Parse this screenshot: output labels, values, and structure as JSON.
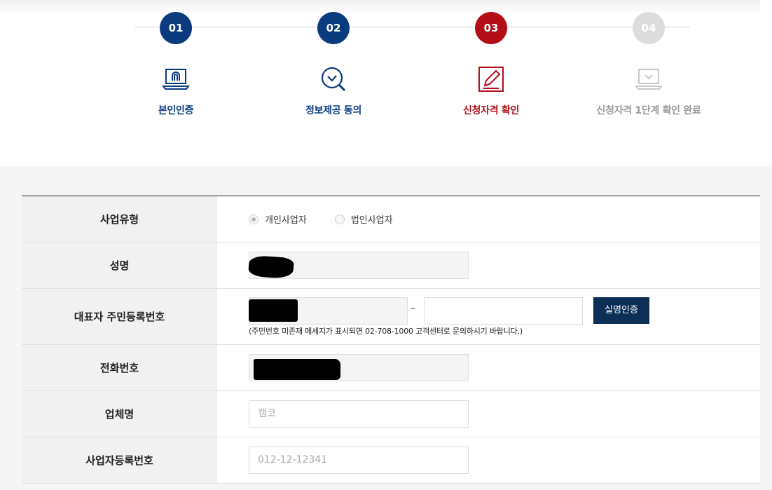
{
  "steps": [
    {
      "num": "01",
      "label": "본인인증",
      "icon": "fingerprint-laptop-icon",
      "state": "done"
    },
    {
      "num": "02",
      "label": "정보제공 동의",
      "icon": "magnifier-check-icon",
      "state": "done"
    },
    {
      "num": "03",
      "label": "신청자격 확인",
      "icon": "document-pen-icon",
      "state": "active"
    },
    {
      "num": "04",
      "label": "신청자격 1단계 확인 완료",
      "icon": "laptop-check-icon",
      "state": "pending"
    }
  ],
  "colors": {
    "done": "#0b3b7f",
    "active": "#b30e17",
    "pending": "#dcdcdc",
    "button": "#0d2f55"
  },
  "form": {
    "business_type": {
      "label": "사업유형",
      "options": [
        "개인사업자",
        "법인사업자"
      ],
      "selected": "개인사업자"
    },
    "name": {
      "label": "성명"
    },
    "resident_no": {
      "label": "대표자 주민등록번호",
      "separator": "–",
      "verify_button": "실명인증",
      "note": "(주민번호 미존재 메세지가 표시되면 02-708-1000 고객센터로 문의하시기 바랍니다.)"
    },
    "phone": {
      "label": "전화번호"
    },
    "company": {
      "label": "업체명",
      "placeholder": "캠코"
    },
    "business_reg_no": {
      "label": "사업자등록번호",
      "placeholder": "012-12-12341"
    }
  }
}
